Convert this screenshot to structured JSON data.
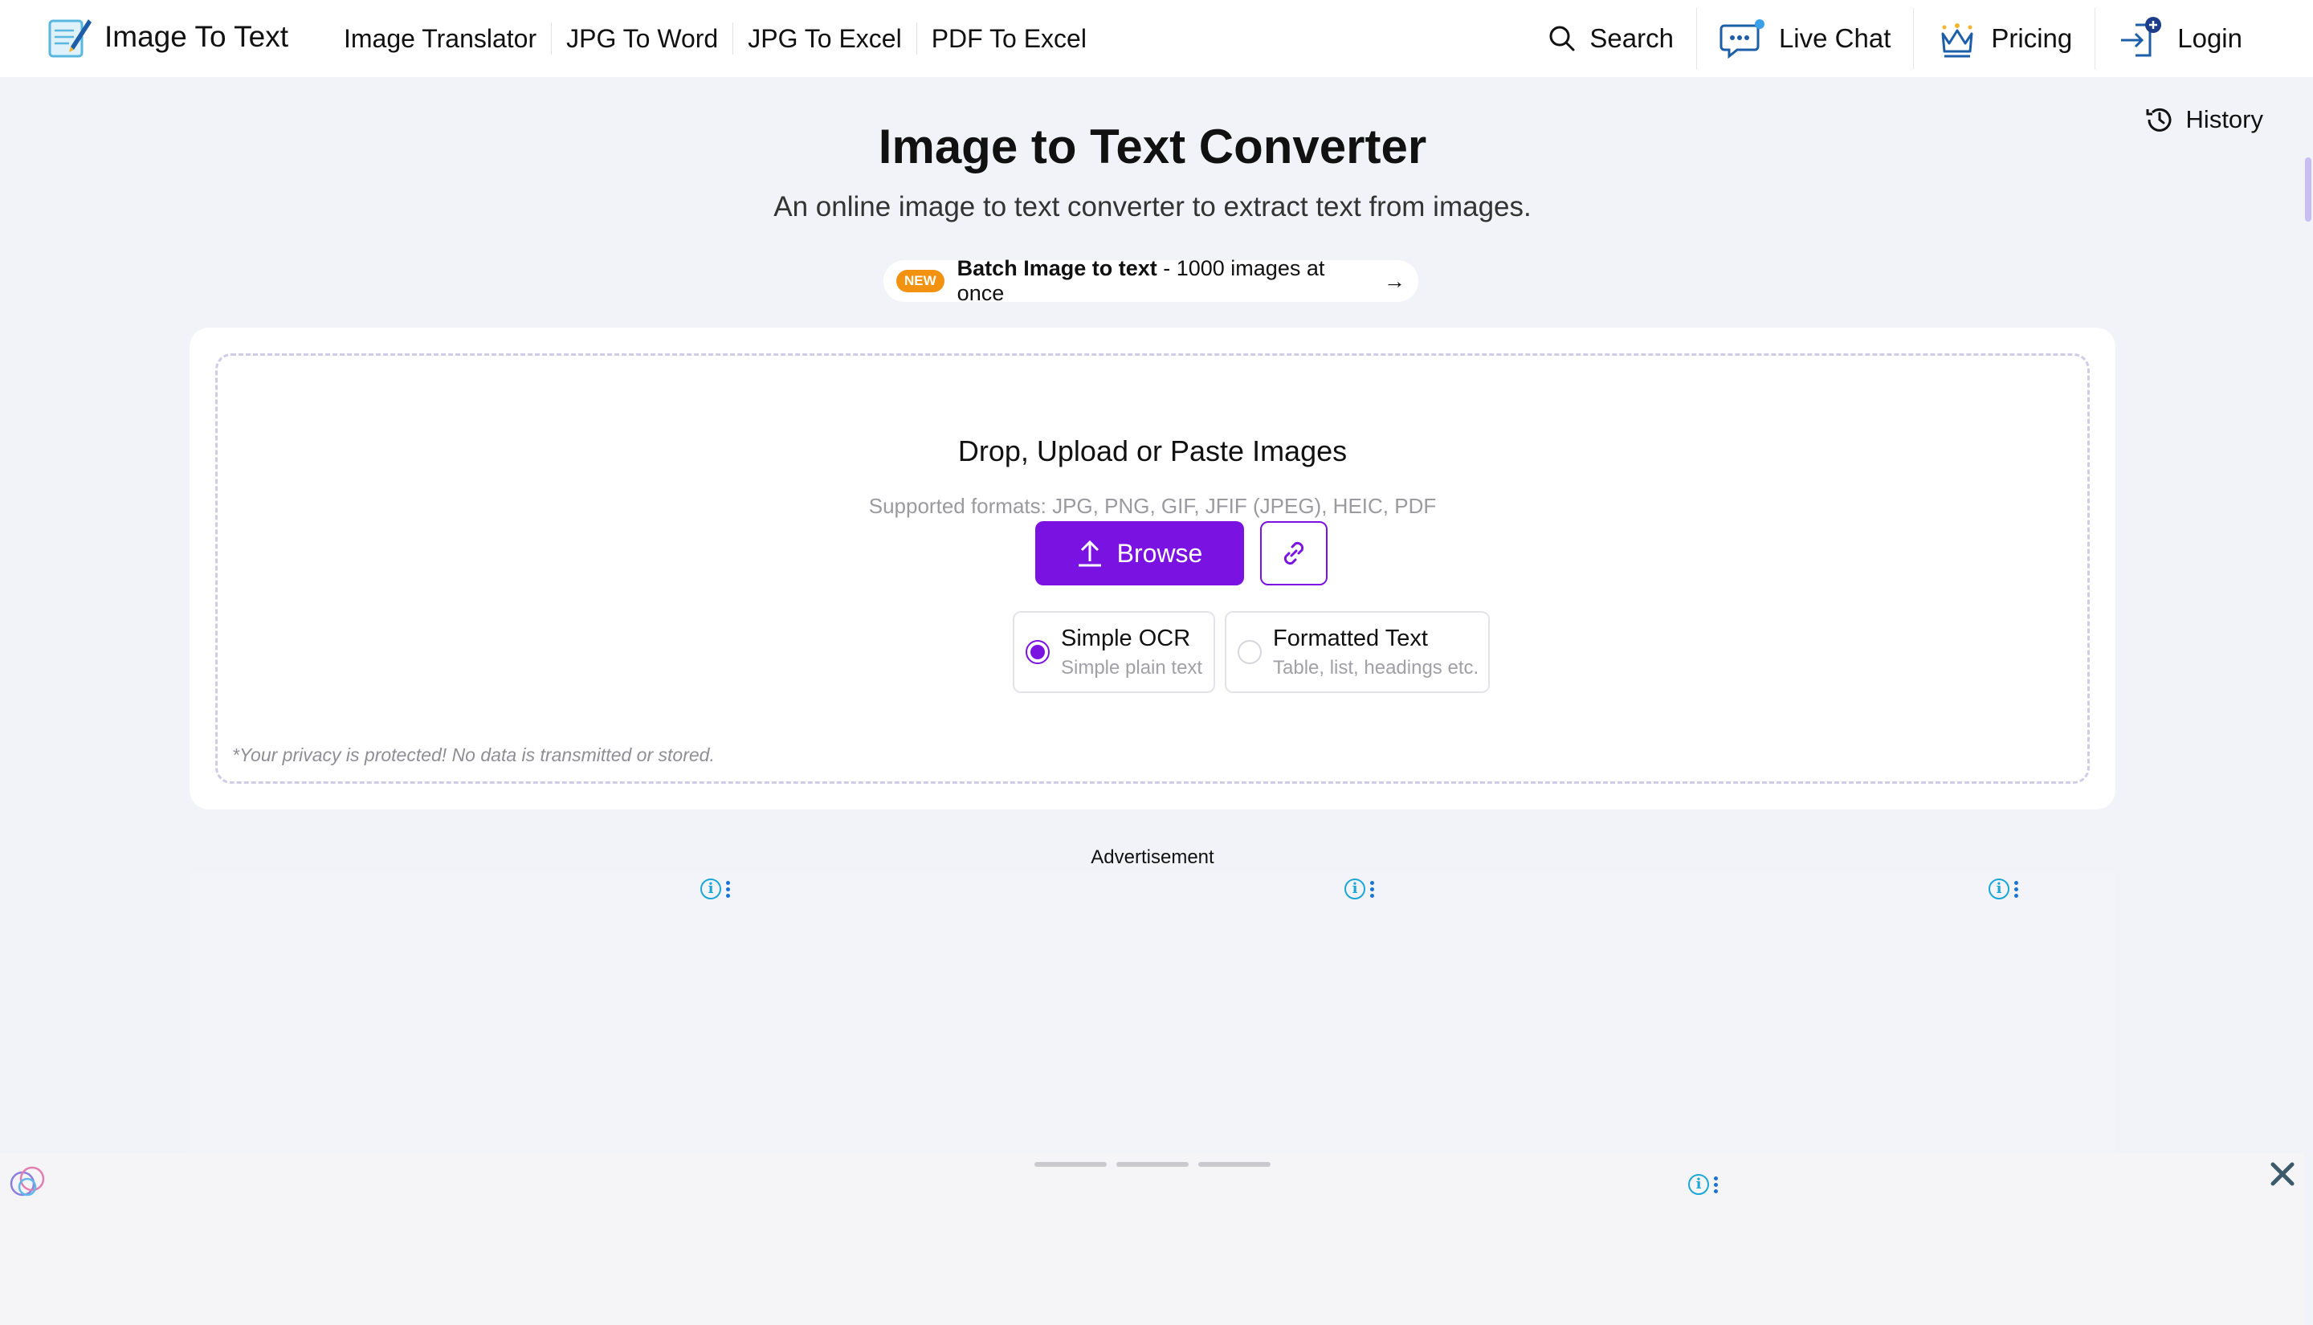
{
  "header": {
    "logo_text": "Image To Text",
    "nav": [
      "Image Translator",
      "JPG To Word",
      "JPG To Excel",
      "PDF To Excel"
    ],
    "search": "Search",
    "live_chat": "Live Chat",
    "pricing": "Pricing",
    "login": "Login"
  },
  "history": "History",
  "hero": {
    "title": "Image to Text Converter",
    "subtitle": "An online image to text converter to extract text from images."
  },
  "promo": {
    "badge": "NEW",
    "bold": "Batch Image to text",
    "rest": " - 1000 images at once",
    "arrow": "→"
  },
  "upload": {
    "title": "Drop, Upload or Paste Images",
    "formats": "Supported formats: JPG, PNG, GIF, JFIF (JPEG), HEIC, PDF",
    "browse": "Browse",
    "options": [
      {
        "title": "Simple OCR",
        "sub": "Simple plain text",
        "checked": true
      },
      {
        "title": "Formatted Text",
        "sub": "Table, list, headings etc.",
        "checked": false
      }
    ],
    "privacy": "*Your privacy is protected! No data is transmitted or stored."
  },
  "ad": {
    "label": "Advertisement",
    "info_glyph": "i"
  },
  "colors": {
    "accent": "#7a13e2",
    "badge": "#f39210",
    "page_bg": "#f2f3f9"
  }
}
